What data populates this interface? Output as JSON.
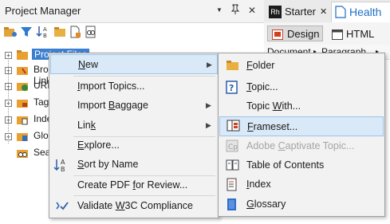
{
  "left_panel": {
    "title": "Project Manager",
    "header_buttons": {
      "dropdown": "▼",
      "pin": "ᵖ",
      "close": "✕"
    },
    "tree": [
      {
        "label": "Project Files",
        "selected": true
      },
      {
        "label": "Broken Links"
      },
      {
        "label": "URLs"
      },
      {
        "label": "Tags"
      },
      {
        "label": "Index"
      },
      {
        "label": "Glossary"
      },
      {
        "label": "Search"
      }
    ]
  },
  "right_panel": {
    "tabs": [
      {
        "badge": "Rh",
        "label": "Starter",
        "close": "✕"
      },
      {
        "label": "Health a"
      }
    ],
    "view_buttons": {
      "design": "Design",
      "html": "HTML"
    },
    "menubar": {
      "document": "Document",
      "paragraph": "Paragraph"
    }
  },
  "context_menu": {
    "items": [
      {
        "label": "New",
        "underline": "N",
        "rest": "ew",
        "submenu": true,
        "highlighted": true
      },
      {
        "label": "Import Topics...",
        "underline": "I",
        "rest": "mport Topics..."
      },
      {
        "label": "Import Baggage",
        "pre": "Import ",
        "underline": "B",
        "rest": "aggage",
        "submenu": true
      },
      {
        "label": "Link",
        "pre": "Lin",
        "underline": "k",
        "rest": "",
        "submenu": true
      },
      {
        "label": "Explore...",
        "underline": "E",
        "rest": "xplore..."
      },
      {
        "label": "Sort by Name",
        "underline": "S",
        "rest": "ort by Name"
      },
      {
        "label": "Create PDF for Review...",
        "pre": "Create PDF ",
        "underline": "f",
        "rest": "or Review..."
      },
      {
        "label": "Validate W3C Compliance",
        "pre": "Validate ",
        "underline": "W",
        "rest": "3C Compliance"
      }
    ]
  },
  "submenu": {
    "items": [
      {
        "label": "Folder",
        "underline": "F",
        "rest": "older",
        "icon": "folder-icon"
      },
      {
        "label": "Topic...",
        "underline": "T",
        "rest": "opic...",
        "icon": "topic-icon"
      },
      {
        "label": "Topic With...",
        "pre": "Topic ",
        "underline": "W",
        "rest": "ith...",
        "icon": ""
      },
      {
        "label": "Frameset...",
        "underline": "F",
        "rest": "rameset...",
        "icon": "frameset-icon",
        "highlighted": true
      },
      {
        "label": "Adobe Captivate Topic...",
        "pre": "Adobe ",
        "underline": "C",
        "rest": "aptivate Topic...",
        "icon": "captivate-icon",
        "disabled": true
      },
      {
        "label": "Table of Contents",
        "underline": "",
        "pre": "Table of Contents",
        "rest": "",
        "icon": "toc-icon"
      },
      {
        "label": "Index",
        "underline": "I",
        "rest": "ndex",
        "icon": "index-icon"
      },
      {
        "label": "Glossary",
        "underline": "G",
        "rest": "lossary",
        "icon": "glossary-icon"
      }
    ]
  },
  "colors": {
    "highlight": "#d9e9f7",
    "highlight_border": "#9cc5ea",
    "selected_node": "#3c7fd1",
    "accent_blue": "#1f6fc5"
  }
}
